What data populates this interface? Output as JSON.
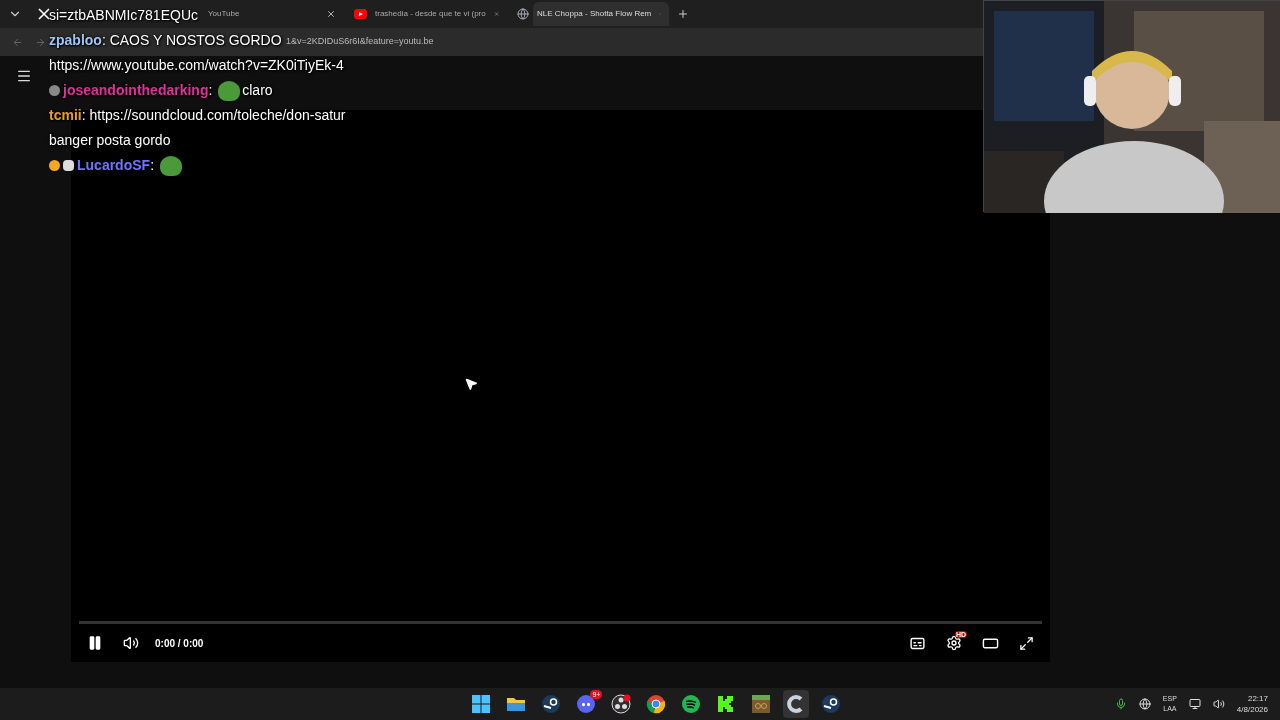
{
  "browser": {
    "tabs": [
      {
        "title": "YouTube",
        "kind": "x",
        "selected": false
      },
      {
        "title": "trashedia - desde que te vi (pro",
        "kind": "youtube",
        "selected": false
      },
      {
        "title": "NLE Choppa - Shotta Flow Rem",
        "kind": "globe",
        "selected": true
      }
    ],
    "address": "1&v=2KDIDuS6r6I&feature=youtu.be"
  },
  "chat": [
    {
      "kind": "text",
      "text": "si=ztbABNMIc781EQUc"
    },
    {
      "kind": "message",
      "user": "zpabloo",
      "color": "#9ec5f5",
      "separator": ":",
      "text": "CAOS Y NOSTOS GORDO"
    },
    {
      "kind": "text",
      "text": "https://www.youtube.com/watch?v=ZK0iTiyEk-4"
    },
    {
      "kind": "message",
      "user": "joseandointhedarking",
      "color": "#e0309a",
      "separator": ":",
      "badges": [
        {
          "color": "#888888"
        }
      ],
      "emote": true,
      "text": "claro"
    },
    {
      "kind": "message",
      "user": "tcmii",
      "color": "#e8a020",
      "separator": ":",
      "text": "https://soundcloud.com/toleche/don-satur banger posta gordo"
    },
    {
      "kind": "message",
      "user": "LucardoSF",
      "color": "#6f73ff",
      "separator": ":",
      "badges": [
        {
          "color": "#f5a623"
        },
        {
          "color": "#dddddd"
        }
      ],
      "emote": true
    }
  ],
  "player": {
    "time": "0:00 / 0:00",
    "settings_badge": "HD"
  },
  "taskbar": {
    "apps": [
      {
        "kind": "start",
        "selected": false
      },
      {
        "kind": "folder",
        "selected": false
      },
      {
        "kind": "steam",
        "selected": false
      },
      {
        "kind": "discord",
        "selected": false,
        "badge": "9+"
      },
      {
        "kind": "obs",
        "selected": false
      },
      {
        "kind": "chrome",
        "selected": false
      },
      {
        "kind": "spotify",
        "selected": false
      },
      {
        "kind": "kick",
        "selected": false
      },
      {
        "kind": "minecraft",
        "selected": false
      },
      {
        "kind": "c-app",
        "selected": true
      },
      {
        "kind": "steam",
        "selected": false
      }
    ],
    "language": [
      "ESP",
      "LAA"
    ],
    "time": "22:17",
    "date": "4/8/2026"
  }
}
